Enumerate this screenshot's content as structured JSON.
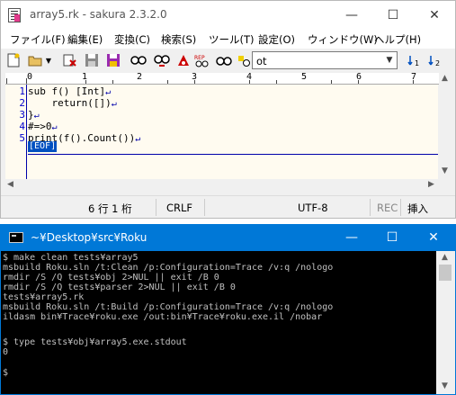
{
  "editor": {
    "title": "array5.rk - sakura 2.3.2.0",
    "controls": {
      "minimize": "—",
      "maximize": "☐",
      "close": "✕"
    },
    "menu": [
      "ファイル(F)",
      "編集(E)",
      "変換(C)",
      "検索(S)",
      "ツール(T)",
      "設定(O)",
      "ウィンドウ(W)",
      "ヘルプ(H)"
    ],
    "search_value": "ot",
    "ruler_numbers": [
      "0",
      "1",
      "2",
      "3",
      "4",
      "5",
      "6",
      "7"
    ],
    "line_numbers": [
      "1",
      "2",
      "3",
      "4",
      "5"
    ],
    "code_lines": [
      "sub f() [Int]",
      "    return([])",
      "}",
      "#=>0",
      "print(f().Count())"
    ],
    "eof_marker": "[EOF]",
    "status": {
      "position": "6 行   1 桁",
      "line_ending": "CRLF",
      "encoding": "UTF-8",
      "rec": "REC",
      "insert_mode": "挿入"
    }
  },
  "console": {
    "title": "~¥Desktop¥src¥Roku",
    "controls": {
      "minimize": "—",
      "maximize": "☐",
      "close": "✕"
    },
    "lines": [
      "$ make clean tests¥array5",
      "msbuild Roku.sln /t:Clean /p:Configuration=Trace /v:q /nologo",
      "rmdir /S /Q tests¥obj 2>NUL || exit /B 0",
      "rmdir /S /Q tests¥parser 2>NUL || exit /B 0",
      "tests¥array5.rk",
      "msbuild Roku.sln /t:Build /p:Configuration=Trace /v:q /nologo",
      "ildasm bin¥Trace¥roku.exe /out:bin¥Trace¥roku.exe.il /nobar",
      "",
      "$ type tests¥obj¥array5.exe.stdout",
      "0",
      "",
      "$"
    ]
  }
}
